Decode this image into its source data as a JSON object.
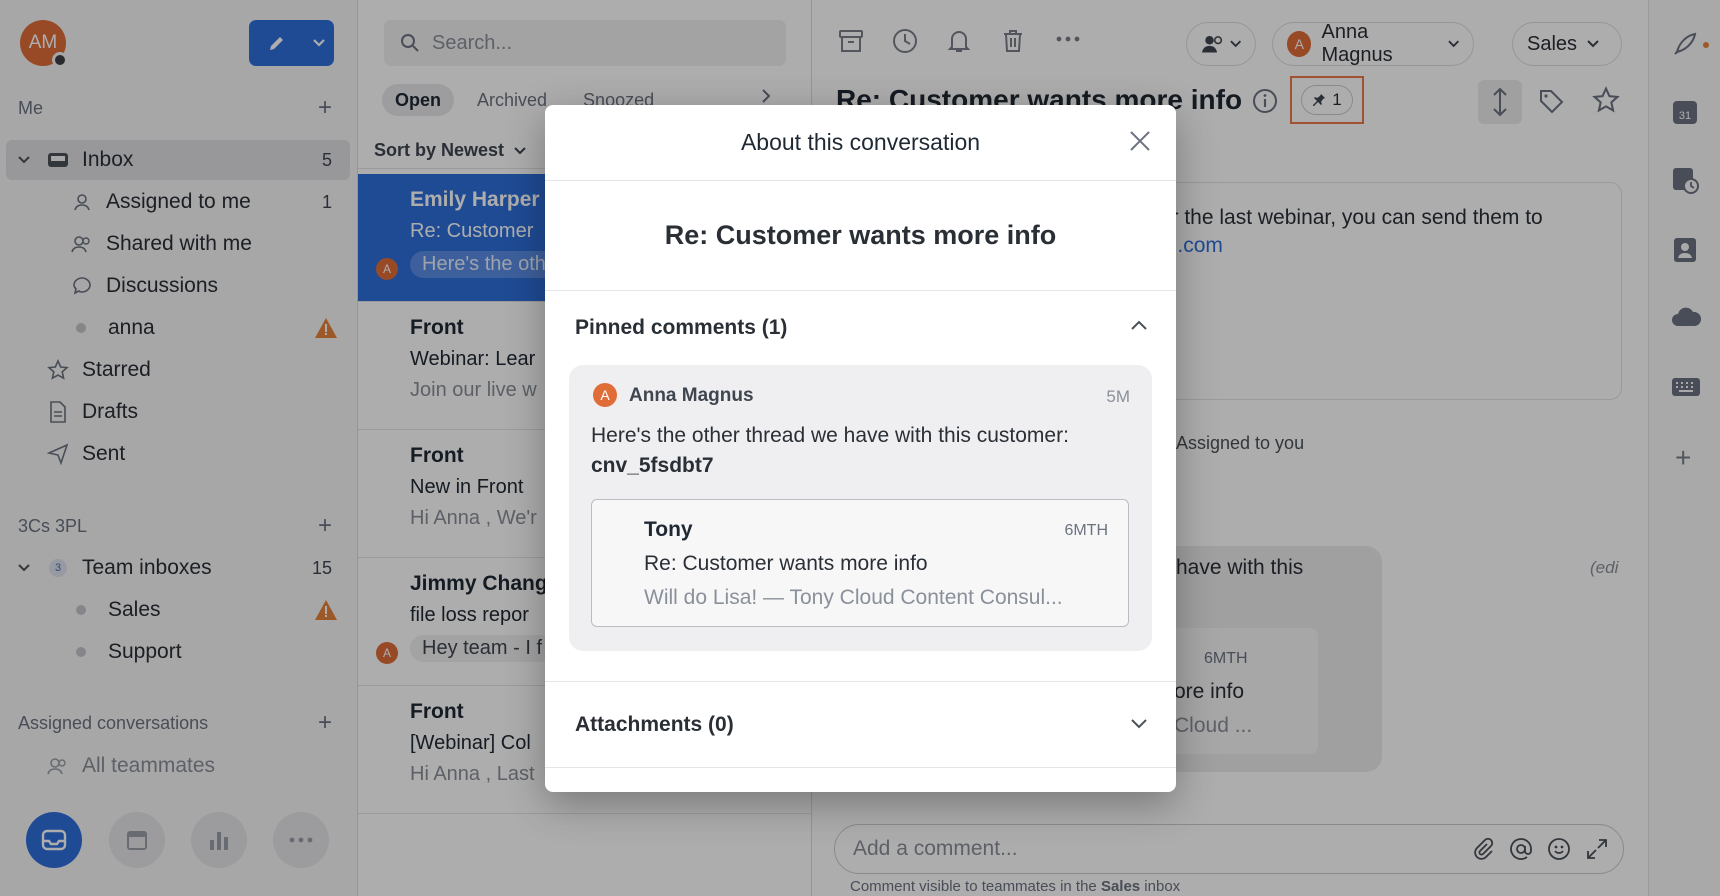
{
  "me": {
    "initials": "AM"
  },
  "sidebar": {
    "me_title": "Me",
    "items": [
      {
        "label": "Inbox",
        "count": "5"
      },
      {
        "label": "Assigned to me",
        "count": "1"
      },
      {
        "label": "Shared with me"
      },
      {
        "label": "Discussions"
      },
      {
        "label": "anna"
      },
      {
        "label": "Starred"
      },
      {
        "label": "Drafts"
      },
      {
        "label": "Sent"
      }
    ],
    "workspace_title": "3Cs 3PL",
    "team": {
      "label": "Team inboxes",
      "badge": "3",
      "count": "15"
    },
    "team_items": [
      {
        "label": "Sales"
      },
      {
        "label": "Support"
      }
    ],
    "assigned_title": "Assigned conversations",
    "all_teammates": "All teammates"
  },
  "list": {
    "search_placeholder": "Search...",
    "tabs": [
      "Open",
      "Archived",
      "Snoozed"
    ],
    "sort_label": "Sort by Newest",
    "conversations": [
      {
        "from": "Emily Harper",
        "subject": "Re: Customer",
        "preview": "Here's the oth",
        "avatar": "A"
      },
      {
        "from": "Front",
        "subject": "Webinar: Lear",
        "preview": "Join our live w"
      },
      {
        "from": "Front",
        "subject": "New in Front",
        "preview": "Hi Anna , We'r"
      },
      {
        "from": "Jimmy Chang",
        "subject": "file loss repor",
        "preview": "Hey team - I f",
        "avatar": "A"
      },
      {
        "from": "Front",
        "subject": "[Webinar] Col",
        "preview": "Hi Anna , Last"
      }
    ]
  },
  "thread": {
    "assignee_initial": "A",
    "assignee": "Anna Magnus",
    "inbox": "Sales",
    "title": "Re: Customer wants more info",
    "pin_count": "1",
    "message_text": "ter the last webinar, you can send them to",
    "message_link": "ng.com",
    "event": "Assigned to you",
    "comment_text": "have with this",
    "comment_card_time": "6MTH",
    "comment_card_subject": "ore info",
    "comment_card_preview": "Cloud ...",
    "edit_label": "(edi",
    "comment_placeholder": "Add a comment...",
    "comment_note_pre": "Comment visible to teammates in the ",
    "comment_note_inbox": "Sales",
    "comment_note_post": " inbox"
  },
  "modal": {
    "title": "About this conversation",
    "subject": "Re: Customer wants more info",
    "pinned_title": "Pinned comments (1)",
    "pinned": {
      "author_initial": "A",
      "author": "Anna Magnus",
      "time": "5M",
      "text": "Here's the other thread we have with this customer:",
      "code": "cnv_5fsdbt7",
      "ref": {
        "from": "Tony",
        "time": "6MTH",
        "subject": "Re: Customer wants more info",
        "preview": "Will do Lisa! — Tony Cloud Content Consul..."
      }
    },
    "attachments_title": "Attachments (0)"
  },
  "calendar_day": "31",
  "colors": {
    "accent": "#2f6fdb",
    "avatar": "#e06c38",
    "warning": "#e8823a",
    "highlight": "#ef7a4a"
  }
}
